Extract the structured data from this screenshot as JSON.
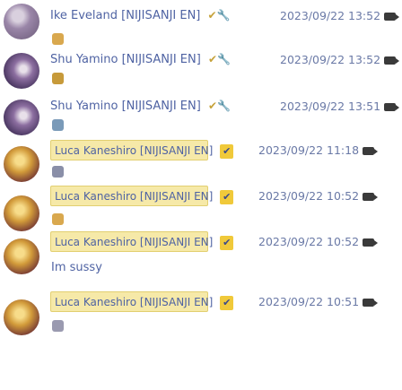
{
  "messages": [
    {
      "author": "Ike Eveland",
      "tag": "[NIJISANJI EN]",
      "badges": "✔🔧",
      "time": "2023/09/22 13:52",
      "body": "",
      "emote_color": "#d9a84e"
    },
    {
      "author": "Shu Yamino",
      "tag": "[NIJISANJI EN]",
      "badges": "✔🔧",
      "time": "2023/09/22 13:52",
      "body": "",
      "emote_color": "#c79a3a"
    },
    {
      "author": "Shu Yamino",
      "tag": "[NIJISANJI EN]",
      "badges": "✔🔧",
      "time": "2023/09/22 13:51",
      "body": "",
      "emote_color": "#7a9ab8"
    },
    {
      "author": "Luca Kaneshiro",
      "tag": "[NIJISANJI EN]",
      "badges": "✔",
      "time": "2023/09/22 11:18",
      "body": "",
      "emote_color": "#8a8fa8"
    },
    {
      "author": "Luca Kaneshiro",
      "tag": "[NIJISANJI EN]",
      "badges": "✔",
      "time": "2023/09/22 10:52",
      "body": "",
      "emote_color": "#d9a84e"
    },
    {
      "author": "Luca Kaneshiro",
      "tag": "[NIJISANJI EN]",
      "badges": "✔",
      "time": "2023/09/22 10:52",
      "body": "Im sussy",
      "emote_color": ""
    },
    {
      "author": "Luca Kaneshiro",
      "tag": "[NIJISANJI EN]",
      "badges": "✔",
      "time": "2023/09/22 10:51",
      "body": "",
      "emote_color": "#9a9ab0"
    }
  ]
}
